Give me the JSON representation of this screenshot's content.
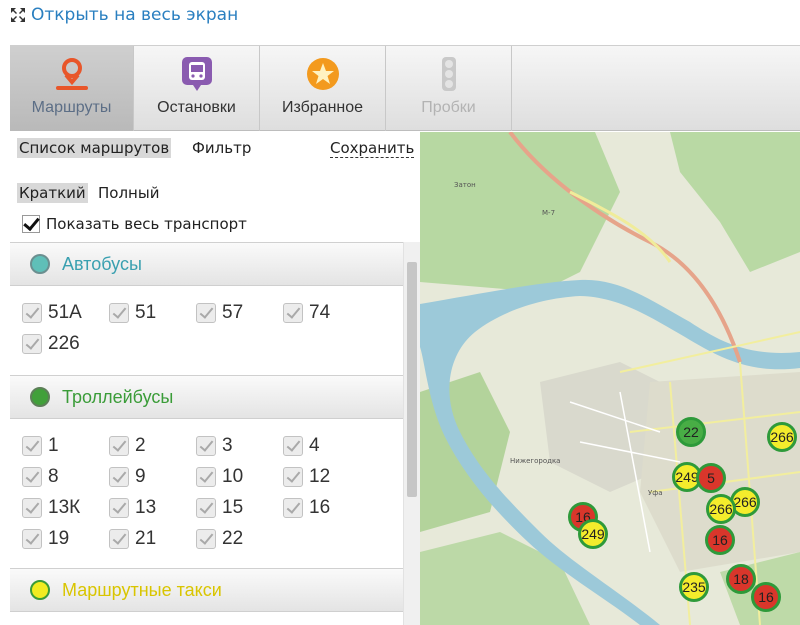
{
  "fullscreen": {
    "label": "Открыть на весь экран",
    "icon": "expand-icon"
  },
  "tabs": [
    {
      "label": "Маршруты",
      "icon": "route-pin-icon",
      "state": "active"
    },
    {
      "label": "Остановки",
      "icon": "bus-stop-icon",
      "state": "normal"
    },
    {
      "label": "Избранное",
      "icon": "star-icon",
      "state": "normal"
    },
    {
      "label": "Пробки",
      "icon": "traffic-light-icon",
      "state": "disabled"
    }
  ],
  "subnav": {
    "list": "Список маршрутов",
    "filter": "Фильтр",
    "save": "Сохранить"
  },
  "view": {
    "short": "Краткий",
    "full": "Полный"
  },
  "show_all": {
    "label": "Показать весь транспорт",
    "checked": true
  },
  "sections": {
    "buses": {
      "title": "Автобусы",
      "color": "#3aa0b0",
      "dot_color": "#5fbfb8",
      "routes": [
        "51А",
        "51",
        "57",
        "74",
        "226"
      ]
    },
    "trolleys": {
      "title": "Троллейбусы",
      "color": "#3a9c38",
      "dot_color": "#41a03a",
      "routes": [
        "1",
        "2",
        "3",
        "4",
        "8",
        "9",
        "10",
        "12",
        "13К",
        "13",
        "15",
        "16",
        "19",
        "21",
        "22"
      ]
    },
    "taxis": {
      "title": "Маршрутные такси",
      "color": "#d9c500",
      "dot_color": "#f1ec21"
    }
  },
  "map": {
    "labels": [
      "Затон",
      "Нижегородка",
      "Уфа",
      "М-7"
    ],
    "markers": [
      {
        "label": "22",
        "color": "green"
      },
      {
        "label": "266",
        "color": "yellow"
      },
      {
        "label": "249",
        "color": "yellow"
      },
      {
        "label": "5",
        "color": "red"
      },
      {
        "label": "266",
        "color": "yellow"
      },
      {
        "label": "266",
        "color": "yellow"
      },
      {
        "label": "16",
        "color": "red"
      },
      {
        "label": "249",
        "color": "yellow"
      },
      {
        "label": "16",
        "color": "red"
      },
      {
        "label": "235",
        "color": "yellow"
      },
      {
        "label": "18",
        "color": "red"
      },
      {
        "label": "16",
        "color": "red"
      }
    ]
  }
}
